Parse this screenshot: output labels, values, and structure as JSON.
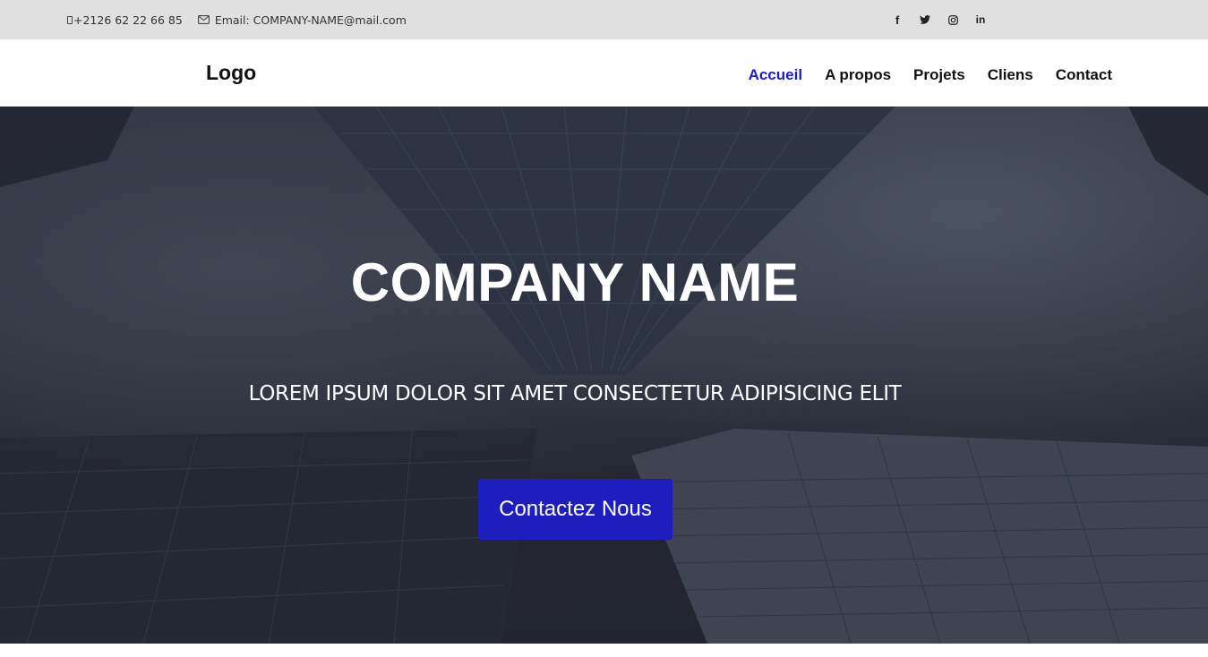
{
  "topbar": {
    "phone": "+2126 62 22 66 85",
    "email": "Email: COMPANY-NAME@mail.com",
    "social": [
      {
        "icon": "facebook-icon",
        "glyph": "f"
      },
      {
        "icon": "twitter-icon",
        "glyph": ""
      },
      {
        "icon": "instagram-icon",
        "glyph": ""
      },
      {
        "icon": "linkedin-icon",
        "glyph": "in"
      }
    ]
  },
  "nav": {
    "logo": "Logo",
    "items": [
      {
        "label": "Accueil",
        "active": true
      },
      {
        "label": "A propos"
      },
      {
        "label": "Projets"
      },
      {
        "label": "Cliens"
      },
      {
        "label": "Contact"
      }
    ],
    "active_color": "#1a1acc"
  },
  "hero": {
    "title": "COMPANY NAME",
    "subtitle": "LOREM IPSUM DOLOR SIT AMET CONSECTETUR ADIPISICING ELIT",
    "cta_label": "Contactez Nous",
    "cta_color": "#1e1ebe"
  }
}
